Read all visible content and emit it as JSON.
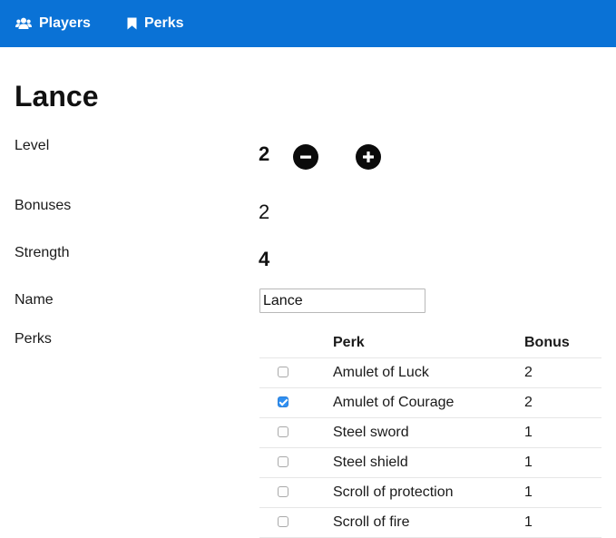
{
  "nav": {
    "players_label": "Players",
    "perks_label": "Perks"
  },
  "player": {
    "name": "Lance",
    "level_label": "Level",
    "level_value": "2",
    "bonuses_label": "Bonuses",
    "bonuses_value": "2",
    "strength_label": "Strength",
    "strength_value": "4",
    "name_label": "Name",
    "name_input_value": "Lance",
    "perks_label": "Perks"
  },
  "perks_table": {
    "headers": {
      "perk": "Perk",
      "bonus": "Bonus"
    },
    "rows": [
      {
        "perk": "Amulet of Luck",
        "bonus": "2",
        "checked": false
      },
      {
        "perk": "Amulet of Courage",
        "bonus": "2",
        "checked": true
      },
      {
        "perk": "Steel sword",
        "bonus": "1",
        "checked": false
      },
      {
        "perk": "Steel shield",
        "bonus": "1",
        "checked": false
      },
      {
        "perk": "Scroll of protection",
        "bonus": "1",
        "checked": false
      },
      {
        "perk": "Scroll of fire",
        "bonus": "1",
        "checked": false
      }
    ]
  },
  "icons": {
    "players": "users-icon",
    "perks": "bookmark-icon",
    "decrement": "minus-circle-icon",
    "increment": "plus-circle-icon"
  },
  "colors": {
    "navbar": "#0a72d6",
    "checkbox_checked": "#2f8ff2"
  }
}
